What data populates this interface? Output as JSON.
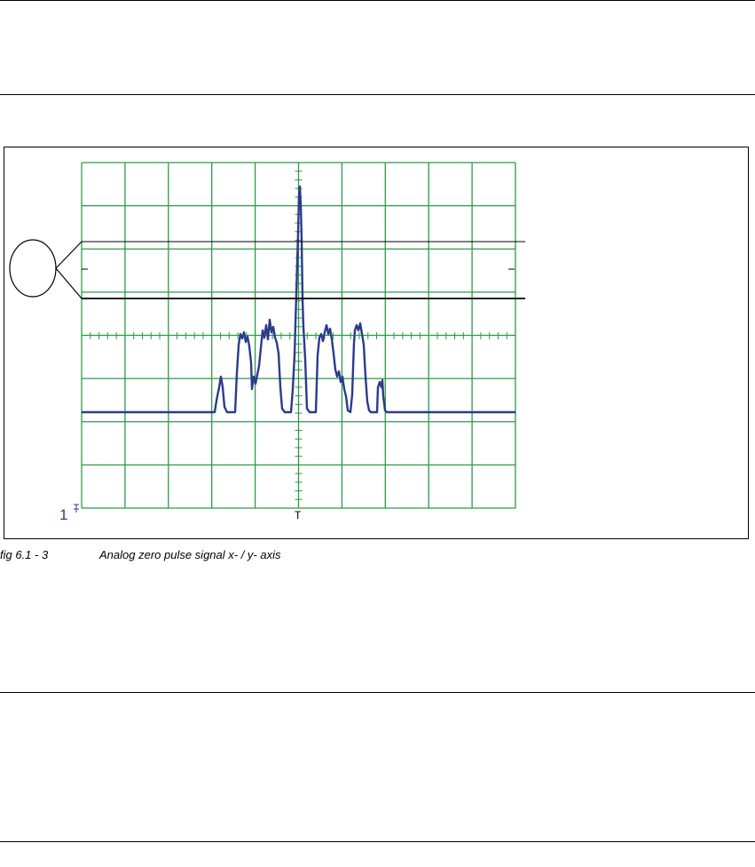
{
  "figure": {
    "caption_number": "fig 6.1 - 3",
    "caption_text": "Analog zero pulse signal x- / y- axis",
    "channel_marker": "1",
    "trigger_marker": "T",
    "colors": {
      "grid": "#2e9a46",
      "trace": "#2b3b8c",
      "lines": "#000000"
    }
  }
}
